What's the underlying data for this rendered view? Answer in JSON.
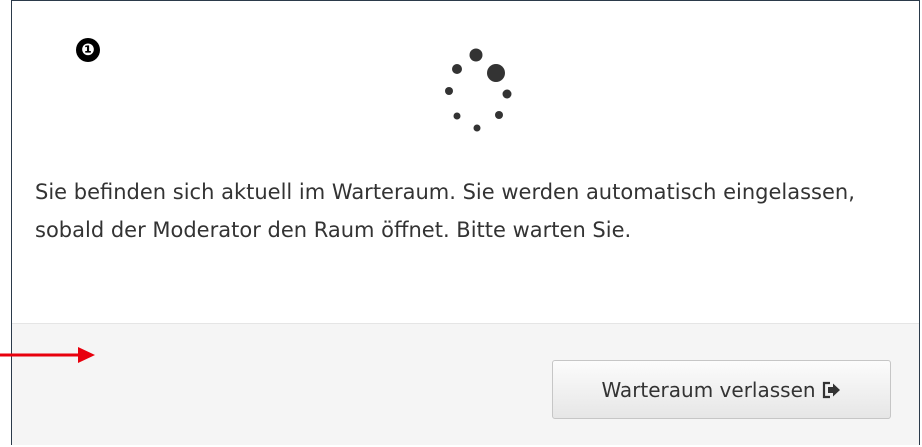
{
  "step_badge": "❶",
  "message": "Sie befinden sich aktuell im Warteraum. Sie werden automatisch eingelassen, sobald der Moderator den Raum öffnet. Bitte warten Sie.",
  "leave_button": {
    "label": "Warteraum verlassen",
    "icon": "sign-out-icon"
  },
  "annotation_arrow_color": "#e8000d",
  "spinner_icon": "loading-spinner-icon"
}
